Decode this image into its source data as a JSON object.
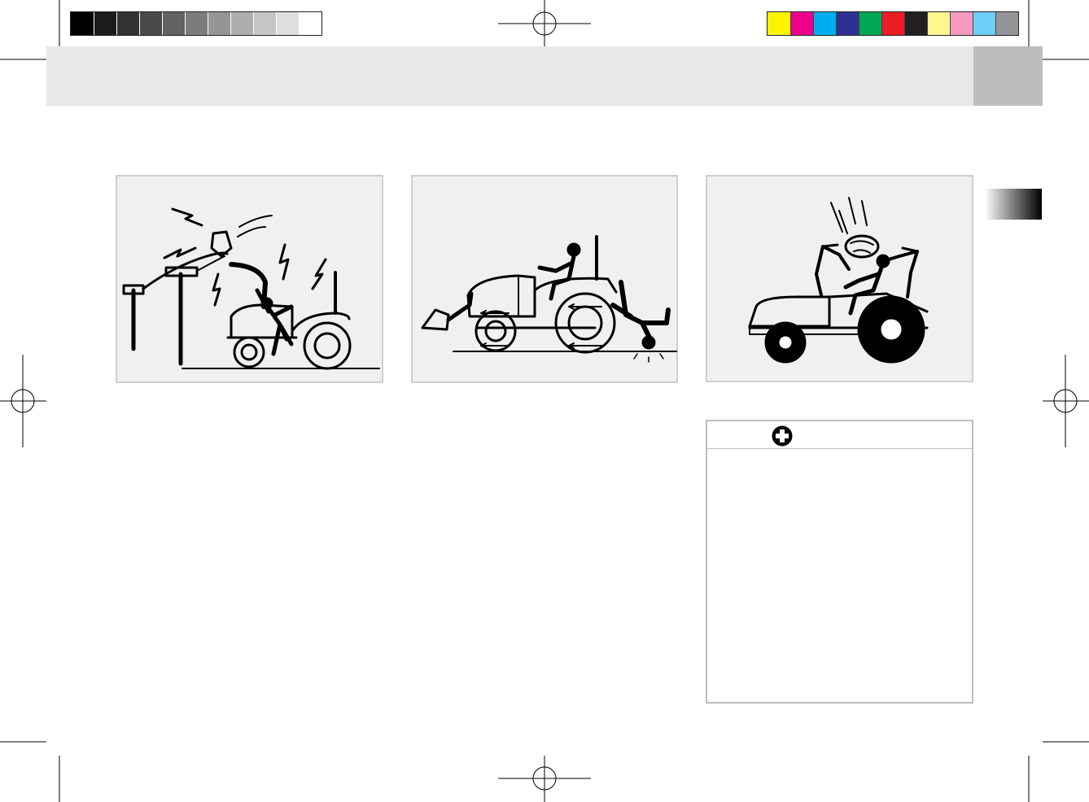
{
  "print_marks": {
    "grayscale_bar": [
      "#000000",
      "#1c1c1c",
      "#333333",
      "#4a4a4a",
      "#636363",
      "#7c7c7c",
      "#959595",
      "#aeaeae",
      "#c6c6c6",
      "#dedede",
      "#ffffff"
    ],
    "color_bar": [
      "#fff200",
      "#ec008c",
      "#00aeef",
      "#2e3192",
      "#00a651",
      "#ed1c24",
      "#231f20",
      "#fff68f",
      "#f49ac1",
      "#6dcff6",
      "#939598"
    ]
  },
  "header": {
    "band_color": "#e8e8e8",
    "tab_color": "#bdbdbd"
  },
  "illustrations": [
    {
      "icon": "tractor-loader-power-line-electrocution"
    },
    {
      "icon": "tractor-runover-bystander"
    },
    {
      "icon": "tractor-falling-object-rops"
    }
  ],
  "note_box": {
    "icon": "first-aid-cross-icon"
  }
}
